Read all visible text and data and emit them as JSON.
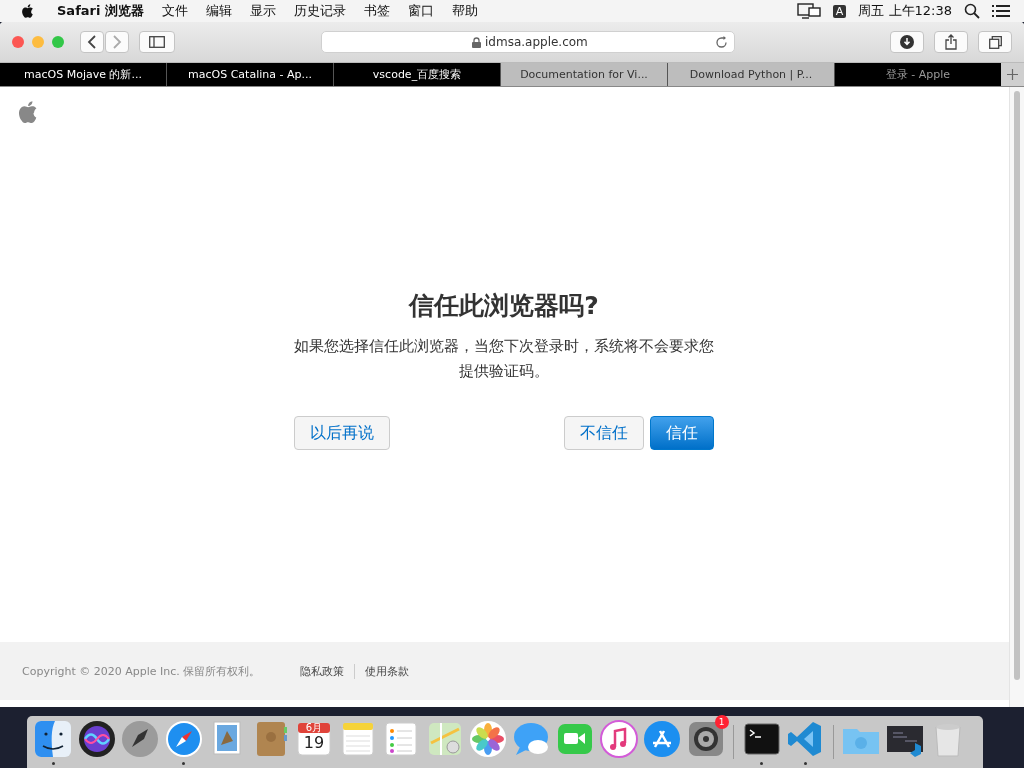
{
  "menu_bar": {
    "app_name": "Safari 浏览器",
    "menus": [
      "文件",
      "编辑",
      "显示",
      "历史记录",
      "书签",
      "窗口",
      "帮助"
    ],
    "input_source": "A",
    "clock": "周五 上午12:38"
  },
  "toolbar": {
    "address": "idmsa.apple.com"
  },
  "tabs": [
    {
      "label": "macOS Mojave 的新...",
      "kind": "dark",
      "selected": false
    },
    {
      "label": "macOS Catalina - Ap...",
      "kind": "dark",
      "selected": false
    },
    {
      "label": "vscode_百度搜索",
      "kind": "dark",
      "selected": false
    },
    {
      "label": "Documentation for Vi...",
      "kind": "light",
      "selected": false
    },
    {
      "label": "Download Python | P...",
      "kind": "light",
      "selected": false
    },
    {
      "label": "登录 - Apple",
      "kind": "dark",
      "selected": true
    }
  ],
  "dialog": {
    "title": "信任此浏览器吗?",
    "message": "如果您选择信任此浏览器，当您下次登录时，系统将不会要求您提供验证码。",
    "buttons": [
      {
        "label": "以后再说",
        "kind": "secondary"
      },
      {
        "label": "不信任",
        "kind": "secondary"
      },
      {
        "label": "信任",
        "kind": "primary"
      }
    ]
  },
  "footer": {
    "copyright": "Copyright © 2020 Apple Inc. 保留所有权利。",
    "links": [
      "隐私政策",
      "使用条款"
    ]
  },
  "dock": {
    "items": [
      {
        "kind": "finder",
        "running": true
      },
      {
        "kind": "siri",
        "running": false
      },
      {
        "kind": "launchpad",
        "running": false
      },
      {
        "kind": "safari",
        "running": true
      },
      {
        "kind": "mail",
        "running": false
      },
      {
        "kind": "contacts",
        "running": false
      },
      {
        "kind": "calendar",
        "running": false,
        "month": "6月",
        "day": "19"
      },
      {
        "kind": "notes",
        "running": false
      },
      {
        "kind": "reminders",
        "running": false
      },
      {
        "kind": "maps",
        "running": false
      },
      {
        "kind": "photos",
        "running": false
      },
      {
        "kind": "messages",
        "running": false
      },
      {
        "kind": "facetime",
        "running": false
      },
      {
        "kind": "music",
        "running": false
      },
      {
        "kind": "appstore",
        "running": false
      },
      {
        "kind": "settings",
        "running": false,
        "badge": "1"
      },
      {
        "kind": "separator"
      },
      {
        "kind": "terminal",
        "running": true
      },
      {
        "kind": "vscode",
        "running": true
      },
      {
        "kind": "separator"
      },
      {
        "kind": "downloads",
        "running": false
      },
      {
        "kind": "window",
        "running": false
      },
      {
        "kind": "trash",
        "running": false
      }
    ]
  }
}
